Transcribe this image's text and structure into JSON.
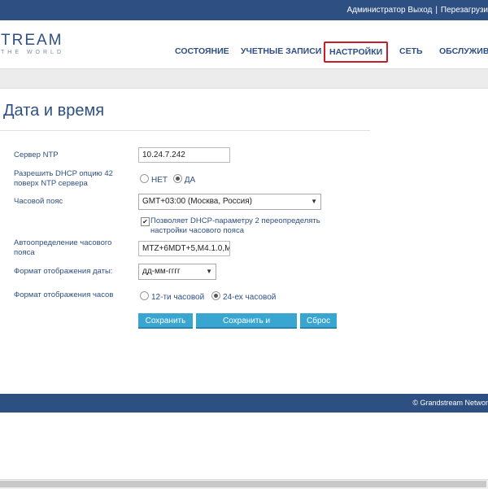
{
  "topbar": {
    "user": "Администратор",
    "logout": "Выход",
    "separator": "|",
    "reboot": "Перезагрузи"
  },
  "logo": {
    "main": "TREAM",
    "sub": "THE WORLD"
  },
  "nav": {
    "items": [
      "СОСТОЯНИЕ",
      "УЧЕТНЫЕ ЗАПИСИ",
      "НАСТРОЙКИ",
      "СЕТЬ",
      "ОБСЛУЖИВА"
    ],
    "active_index": 2
  },
  "page": {
    "title": "Дата и время"
  },
  "form": {
    "ntp_label": "Сервер NTP",
    "ntp_value": "10.24.7.242",
    "dhcp42_label": "Разрешить DHCP опцию 42 поверх NTP сервера",
    "no_label": "НЕТ",
    "yes_label": "ДА",
    "dhcp42_selected": "ДА",
    "timezone_label": "Часовой пояс",
    "timezone_value": "GMT+03:00 (Москва, Россия)",
    "dhcp2_override_label": "Позволяет DHCP-параметру 2 переопределять настройки часового пояса",
    "dhcp2_override_checked": true,
    "auto_tz_label": "Автоопределение часового пояса",
    "auto_tz_value": "MTZ+6MDT+5,M4.1.0,M",
    "date_format_label": "Формат отображения даты:",
    "date_format_value": "дд-мм-гггг",
    "time_format_label": "Формат отображения часов",
    "h12_label": "12-ти часовой",
    "h24_label": "24-ех часовой",
    "time_format_selected": "24-ех часовой"
  },
  "buttons": {
    "save": "Сохранить",
    "save_apply": "Сохранить и применить",
    "reset": "Сброс"
  },
  "footer": {
    "copyright": "© Grandstream Networ"
  },
  "colors": {
    "brand": "#2e4f82",
    "button": "#39a6d2",
    "active_outline": "#c91c24"
  }
}
